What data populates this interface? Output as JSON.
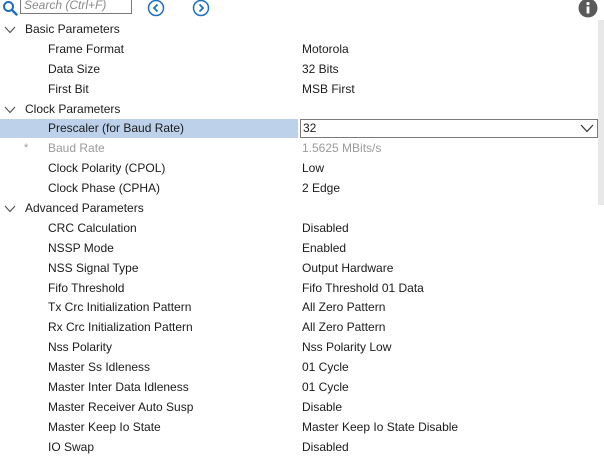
{
  "search": {
    "placeholder": "Search (Ctrl+F)"
  },
  "icons": {
    "search": "search-icon",
    "prev": "circle-chevron-left-icon",
    "next": "circle-chevron-right-icon",
    "info": "info-icon",
    "accent": "#1e6fc0"
  },
  "groups": [
    {
      "label": "Basic Parameters",
      "items": [
        {
          "label": "Frame Format",
          "value": "Motorola"
        },
        {
          "label": "Data Size",
          "value": "32 Bits"
        },
        {
          "label": "First Bit",
          "value": "MSB First"
        }
      ]
    },
    {
      "label": "Clock Parameters",
      "items": [
        {
          "label": "Prescaler (for Baud Rate)",
          "value": "32"
        },
        {
          "label": "Baud Rate",
          "value": "1.5625 MBits/s",
          "marker": "*"
        },
        {
          "label": "Clock Polarity (CPOL)",
          "value": "Low"
        },
        {
          "label": "Clock Phase (CPHA)",
          "value": "2 Edge"
        }
      ]
    },
    {
      "label": "Advanced Parameters",
      "items": [
        {
          "label": "CRC Calculation",
          "value": "Disabled"
        },
        {
          "label": "NSSP Mode",
          "value": "Enabled"
        },
        {
          "label": "NSS Signal Type",
          "value": "Output Hardware"
        },
        {
          "label": "Fifo Threshold",
          "value": "Fifo Threshold 01 Data"
        },
        {
          "label": "Tx Crc Initialization Pattern",
          "value": "All Zero Pattern"
        },
        {
          "label": "Rx Crc Initialization Pattern",
          "value": "All Zero Pattern"
        },
        {
          "label": "Nss Polarity",
          "value": "Nss Polarity Low"
        },
        {
          "label": "Master Ss Idleness",
          "value": "01 Cycle"
        },
        {
          "label": "Master Inter Data Idleness",
          "value": "01 Cycle"
        },
        {
          "label": "Master Receiver Auto Susp",
          "value": "Disable"
        },
        {
          "label": "Master Keep Io State",
          "value": "Master Keep Io State Disable"
        },
        {
          "label": "IO Swap",
          "value": "Disabled"
        }
      ]
    }
  ]
}
